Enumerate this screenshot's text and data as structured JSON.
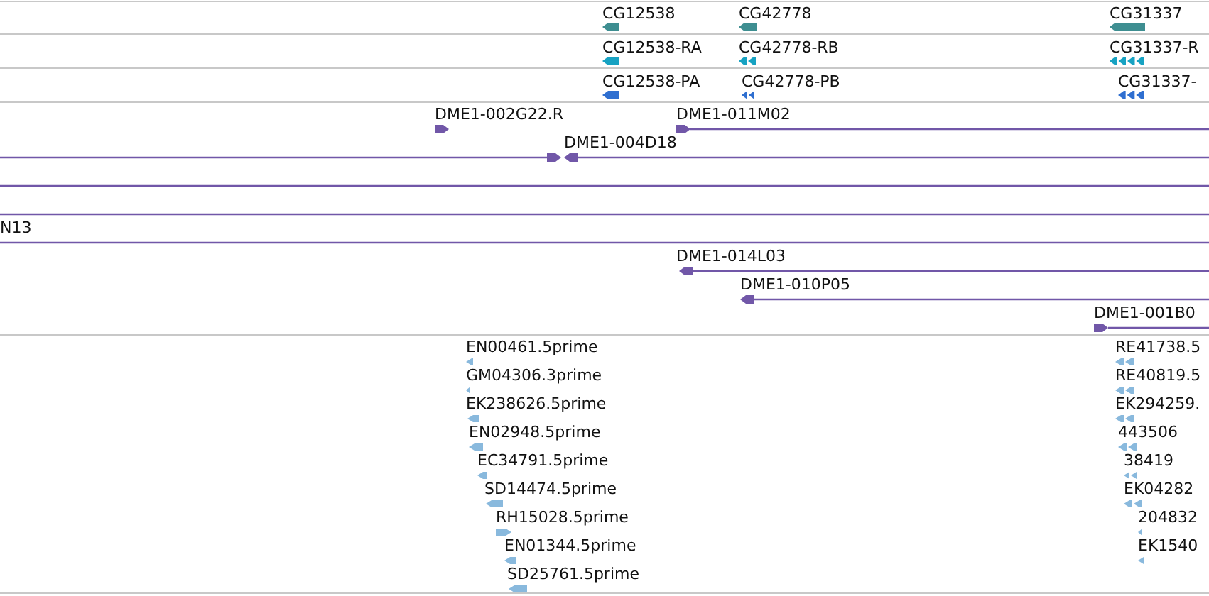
{
  "tracks": [
    {
      "kind": "gene",
      "features": [
        {
          "label": "CG12538",
          "kind": "single",
          "reverse": true
        },
        {
          "label": "CG42778",
          "kind": "single",
          "reverse": true
        },
        {
          "label": "CG31337",
          "kind": "single",
          "reverse": true
        }
      ]
    },
    {
      "kind": "transcript",
      "features": [
        {
          "label": "CG12538-RA",
          "kind": "single",
          "reverse": true
        },
        {
          "label": "CG42778-RB",
          "kind": "multi",
          "reverse": true
        },
        {
          "label": "CG31337-R",
          "kind": "multi",
          "reverse": true
        }
      ]
    },
    {
      "kind": "protein",
      "features": [
        {
          "label": "CG12538-PA",
          "kind": "single",
          "reverse": true
        },
        {
          "label": "CG42778-PB",
          "kind": "multi",
          "reverse": true
        },
        {
          "label": "CG31337-",
          "kind": "multi",
          "reverse": true
        }
      ]
    },
    {
      "kind": "clone",
      "features": [
        {
          "label": "DME1-002G22.R",
          "kind": "end",
          "reverse": false
        },
        {
          "label": "DME1-011M02",
          "kind": "end",
          "reverse": false
        },
        {
          "label": "DME1-004D18",
          "kind": "pair",
          "reverse": true
        },
        {
          "kind": "span"
        },
        {
          "kind": "span"
        },
        {
          "label": "N13",
          "kind": "span"
        },
        {
          "label": "DME1-014L03",
          "kind": "end",
          "reverse": true
        },
        {
          "label": "DME1-010P05",
          "kind": "end",
          "reverse": true
        },
        {
          "label": "DME1-001B0",
          "kind": "end",
          "reverse": false
        }
      ]
    },
    {
      "kind": "est",
      "features": [
        {
          "label": "EN00461.5prime",
          "kind": "single",
          "reverse": true
        },
        {
          "label": "GM04306.3prime",
          "kind": "single",
          "reverse": true
        },
        {
          "label": "EK238626.5prime",
          "kind": "single",
          "reverse": true
        },
        {
          "label": "EN02948.5prime",
          "kind": "single",
          "reverse": true
        },
        {
          "label": "EC34791.5prime",
          "kind": "single",
          "reverse": true
        },
        {
          "label": "SD14474.5prime",
          "kind": "single",
          "reverse": true
        },
        {
          "label": "RH15028.5prime",
          "kind": "single",
          "reverse": false
        },
        {
          "label": "EN01344.5prime",
          "kind": "single",
          "reverse": true
        },
        {
          "label": "SD25761.5prime",
          "kind": "single",
          "reverse": true
        },
        {
          "label": "RE41738.5",
          "kind": "multi",
          "reverse": true
        },
        {
          "label": "RE40819.5",
          "kind": "multi",
          "reverse": true
        },
        {
          "label": "EK294259.",
          "kind": "multi",
          "reverse": true
        },
        {
          "label": "443506",
          "kind": "multi",
          "reverse": true
        },
        {
          "label": "38419",
          "kind": "multi",
          "reverse": true
        },
        {
          "label": "EK04282",
          "kind": "multi",
          "reverse": true
        },
        {
          "label": "204832",
          "kind": "single",
          "reverse": true
        },
        {
          "label": "EK1540",
          "kind": "single",
          "reverse": true
        }
      ]
    }
  ]
}
